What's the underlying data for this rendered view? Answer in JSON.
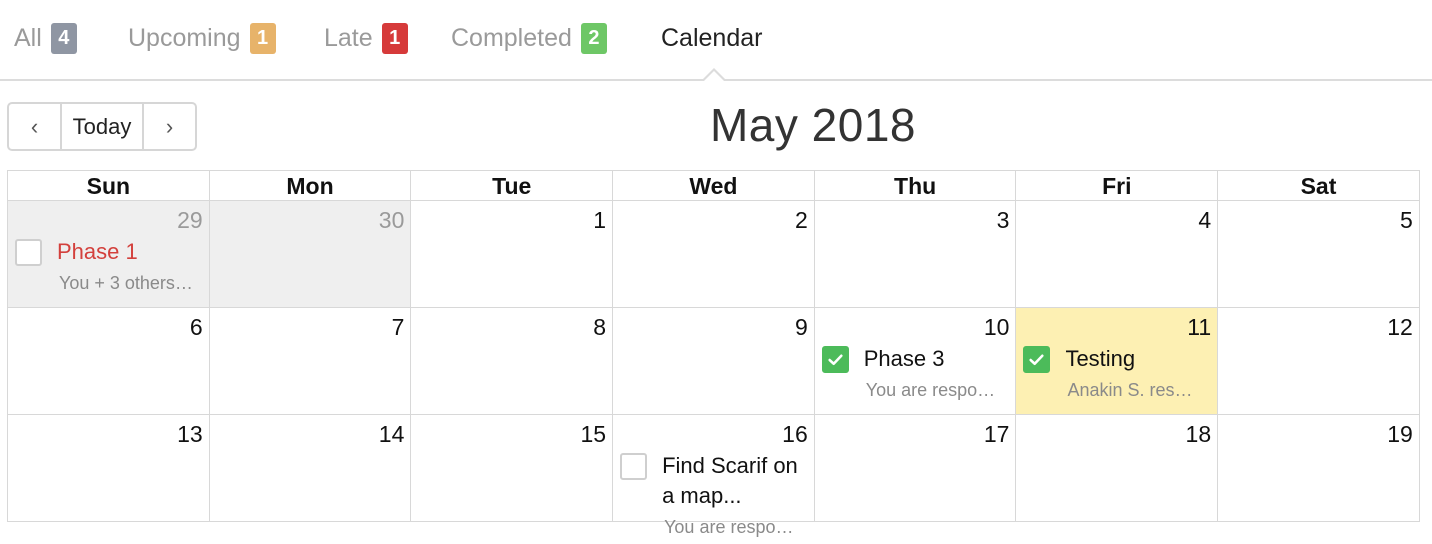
{
  "tabs": [
    {
      "label": "All",
      "count": "4",
      "color": "#8f96a3"
    },
    {
      "label": "Upcoming",
      "count": "1",
      "color": "#e7b36a"
    },
    {
      "label": "Late",
      "count": "1",
      "color": "#d63a3a"
    },
    {
      "label": "Completed",
      "count": "2",
      "color": "#6ec766"
    },
    {
      "label": "Calendar",
      "active": true
    }
  ],
  "nav": {
    "prev": "‹",
    "today": "Today",
    "next": "›"
  },
  "calendar": {
    "title": "May 2018",
    "weekdays": [
      "Sun",
      "Mon",
      "Tue",
      "Wed",
      "Thu",
      "Fri",
      "Sat"
    ],
    "weeks": [
      [
        {
          "day": "29",
          "other": true,
          "event": {
            "title": "Phase 1",
            "sub": "You + 3 others…",
            "done": false,
            "late": true
          }
        },
        {
          "day": "30",
          "other": true
        },
        {
          "day": "1"
        },
        {
          "day": "2"
        },
        {
          "day": "3"
        },
        {
          "day": "4"
        },
        {
          "day": "5"
        }
      ],
      [
        {
          "day": "6"
        },
        {
          "day": "7"
        },
        {
          "day": "8"
        },
        {
          "day": "9"
        },
        {
          "day": "10",
          "event": {
            "title": "Phase 3",
            "sub": "You are respo…",
            "done": true
          }
        },
        {
          "day": "11",
          "today": true,
          "event": {
            "title": "Testing",
            "sub": "Anakin S. res…",
            "done": true
          }
        },
        {
          "day": "12"
        }
      ],
      [
        {
          "day": "13"
        },
        {
          "day": "14"
        },
        {
          "day": "15"
        },
        {
          "day": "16",
          "event": {
            "title": "Find Scarif on a map...",
            "sub": "You are respo…",
            "done": false
          }
        },
        {
          "day": "17"
        },
        {
          "day": "18"
        },
        {
          "day": "19"
        }
      ]
    ]
  }
}
